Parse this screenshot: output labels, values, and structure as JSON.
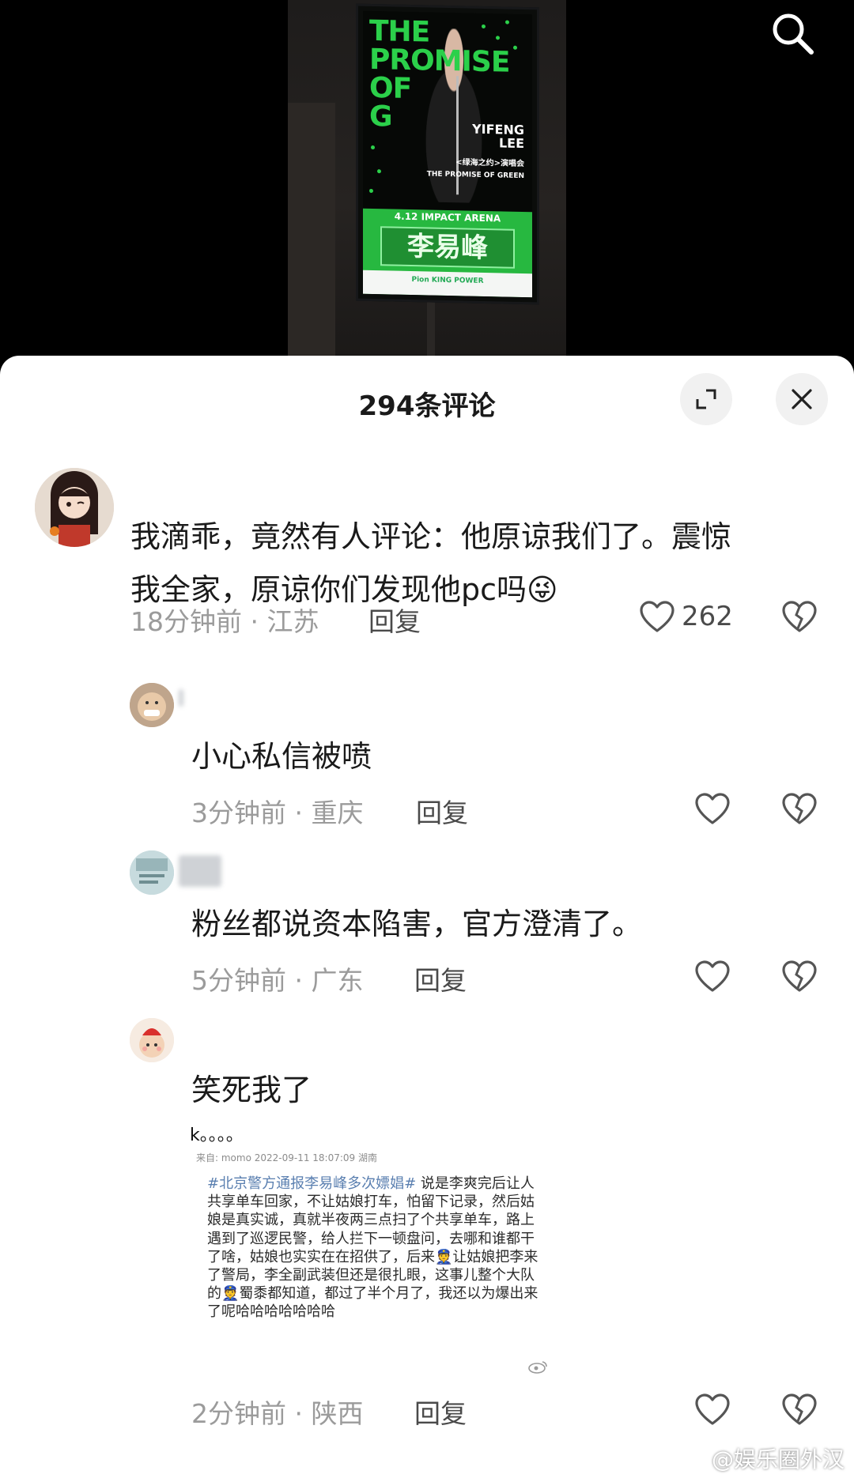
{
  "poster": {
    "title_line1": "THE",
    "title_line2": "PROMISE",
    "title_line3": "OF",
    "title_line4": "G",
    "name_en_1": "YIFENG",
    "name_en_2": "LEE",
    "subtitle_cn": "<绿海之约>演唱会",
    "subtitle_en": "THE PROMISE OF GREEN",
    "venue": "4.12 IMPACT ARENA",
    "name_cn": "李易峰",
    "footer": "Pion KING POWER"
  },
  "header": {
    "title": "294条评论"
  },
  "comments": [
    {
      "text_line1": "我滴乖，竟然有人评论：他原谅我们了。震惊",
      "text_line2": "我全家，原谅你们发现他pc吗",
      "emoji": "😜",
      "meta": "18分钟前 · 江苏",
      "reply": "回复",
      "likes": "262"
    },
    {
      "text": "小心私信被喷",
      "meta": "3分钟前 · 重庆",
      "reply": "回复"
    },
    {
      "text": "粉丝都说资本陷害，官方澄清了。",
      "meta": "5分钟前 · 广东",
      "reply": "回复"
    },
    {
      "text": "笑死我了",
      "meta": "2分钟前 · 陕西",
      "reply": "回复",
      "quote": {
        "dots": "k。。。。",
        "source": "来自: momo    2022-09-11 18:07:09 湖南",
        "hashtag": "#北京警方通报李易峰多次嫖娼#",
        "body": " 说是李爽完后让人共享单车回家，不让姑娘打车，怕留下记录，然后姑娘是真实诚，真就半夜两三点扫了个共享单车，路上遇到了巡逻民警，给人拦下一顿盘问，去哪和谁都干了啥，姑娘也实实在在招供了，后来👮让姑娘把李来了警局，李全副武装但还是很扎眼，这事儿整个大队的👮蜀黍都知道，都过了半个月了，我还以为爆出来了呢哈哈哈哈哈哈哈"
      }
    }
  ],
  "watermark": "@娱乐圈外汉"
}
